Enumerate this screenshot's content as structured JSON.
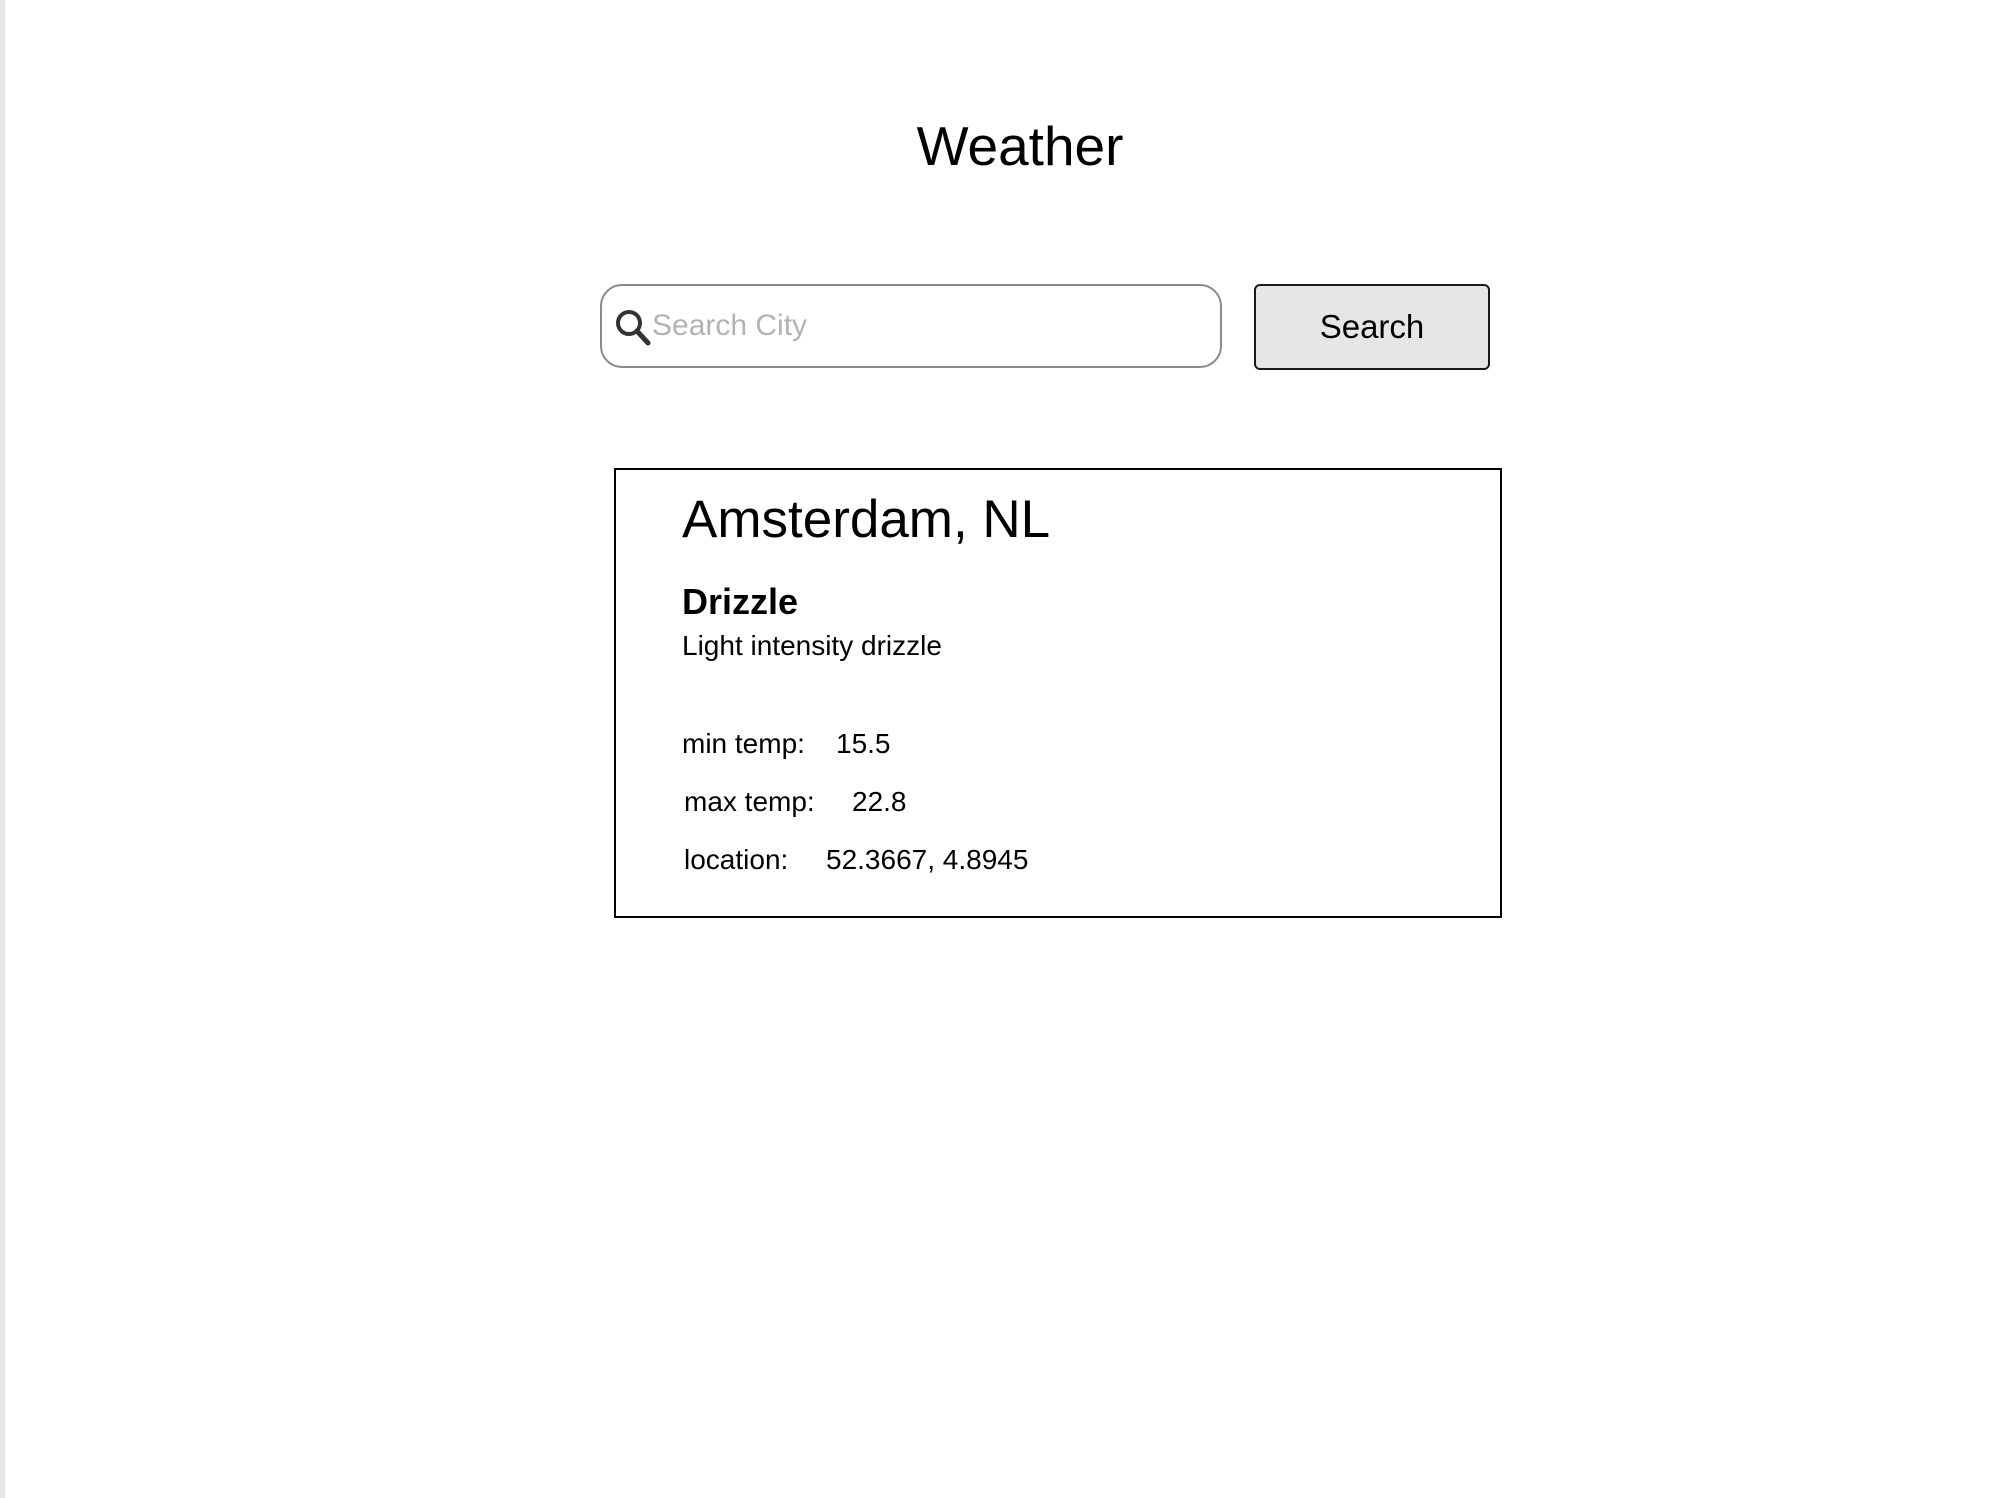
{
  "header": {
    "title": "Weather"
  },
  "search": {
    "placeholder": "Search City",
    "value": "",
    "button_label": "Search",
    "icon": "search-icon"
  },
  "weather": {
    "city": "Amsterdam, NL",
    "condition": "Drizzle",
    "description": "Light intensity drizzle",
    "min_temp_label": "min temp:",
    "min_temp": "15.5",
    "max_temp_label": "max temp:",
    "max_temp": "22.8",
    "location_label": "location:",
    "location": "52.3667, 4.8945"
  },
  "colors": {
    "background": "#ffffff",
    "text": "#000000",
    "placeholder": "#b3b3b3",
    "button_bg": "#e6e6e6",
    "input_border": "#8a8a8a"
  }
}
